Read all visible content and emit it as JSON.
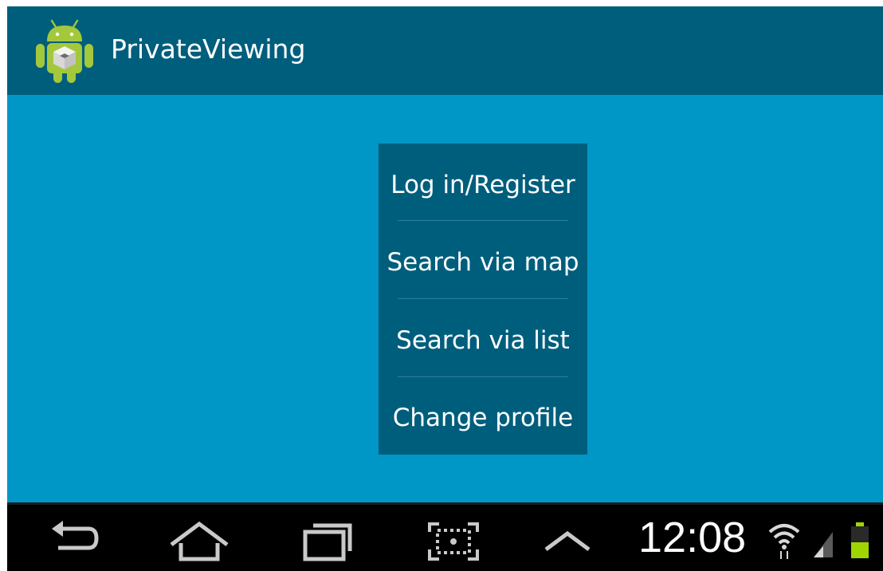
{
  "app": {
    "title": "PrivateViewing",
    "icon": "android-app-icon"
  },
  "menu": {
    "items": [
      {
        "label": "Log in/Register"
      },
      {
        "label": "Search via map"
      },
      {
        "label": "Search via list"
      },
      {
        "label": "Change profile"
      }
    ]
  },
  "navbar": {
    "buttons": [
      {
        "icon": "back-icon"
      },
      {
        "icon": "home-icon"
      },
      {
        "icon": "recent-apps-icon"
      },
      {
        "icon": "screenshot-icon"
      },
      {
        "icon": "chevron-up-icon"
      }
    ]
  },
  "status": {
    "time": "12:08",
    "wifi_icon": "wifi-icon",
    "signal_icon": "signal-icon",
    "battery_icon": "battery-icon"
  },
  "colors": {
    "action_bar": "#005e7d",
    "content_bg": "#0097c6",
    "menu_bg": "#005e7d",
    "nav_bar": "#000000",
    "battery": "#9fd600"
  }
}
